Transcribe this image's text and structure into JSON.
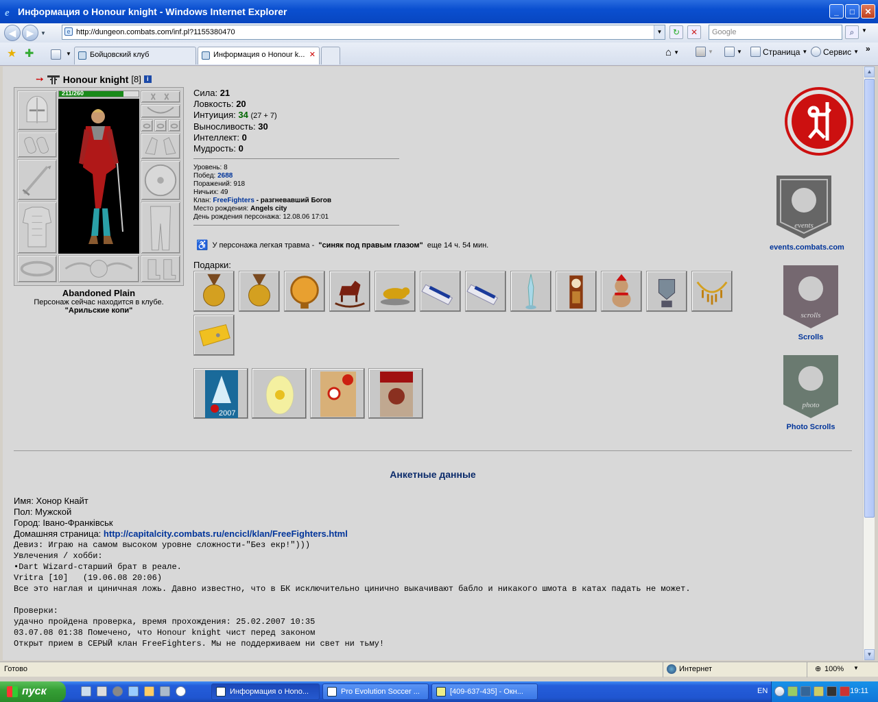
{
  "window": {
    "title": "Информация о Honour knight - Windows Internet Explorer",
    "address": "http://dungeon.combats.com/inf.pl?1155380470",
    "search_placeholder": "Google"
  },
  "tabs": [
    {
      "label": "Бойцовский клуб"
    },
    {
      "label": "Информация о Honour k..."
    }
  ],
  "toolbar": {
    "page": "Страница",
    "tools": "Сервис"
  },
  "character": {
    "name": "Honour knight",
    "level": "[8]",
    "hp": "211/260",
    "hp_fraction": 0.81,
    "location": "Abandoned Plain",
    "status_line": "Персонаж сейчас находится в клубе.",
    "place": "\"Арильские копи\""
  },
  "stats": {
    "strength_label": "Сила:",
    "strength": "21",
    "agility_label": "Ловкость:",
    "agility": "20",
    "intuition_label": "Интуиция:",
    "intuition": "34",
    "intuition_extra": "(27 + 7)",
    "endurance_label": "Выносливость:",
    "endurance": "30",
    "intellect_label": "Интеллект:",
    "intellect": "0",
    "wisdom_label": "Мудрость:",
    "wisdom": "0"
  },
  "record": {
    "level_label": "Уровень:",
    "level": "8",
    "wins_label": "Побед:",
    "wins": "2688",
    "losses_label": "Поражений:",
    "losses": "918",
    "draws_label": "Ничьих:",
    "draws": "49",
    "clan_label": "Клан:",
    "clan": "FreeFighters",
    "clan_title": "- разгневавший Богов",
    "birthplace_label": "Место рождения:",
    "birthplace": "Angels city",
    "birthday_label": "День рождения персонажа:",
    "birthday": "12.08.06 17:01"
  },
  "injury": {
    "prefix": "У персонажа легкая травма -",
    "name": "\"синяк под правым глазом\"",
    "suffix": "еще 14 ч. 54 мин."
  },
  "gifts_label": "Подарки:",
  "banners": {
    "events": "events.combats.com",
    "events_word": "events",
    "scrolls": "Scrolls",
    "scrolls_word": "scrolls",
    "photo": "Photo Scrolls",
    "photo_word": "photo",
    "year": "2007"
  },
  "profile": {
    "heading": "Анкетные данные",
    "name_line": "Имя: Хонор Кнайт",
    "sex_line": "Пол: Мужской",
    "city_line": "Город: Івано-Франківськ",
    "homepage_label": "Домашняя страница:",
    "homepage": "http://capitalcity.combats.ru/encicl/klan/FreeFighters.html",
    "motto_line": "Девиз: Играю на самом высоком уровне сложности-\"Без екр!\")))",
    "hobbies_label": "Увлечения / хобби:",
    "hobby1": "•Dart Wizard-старший брат в реале.",
    "hobby2": "Vritra [10]   (19.06.08 20:06)",
    "hobby3": "Все это наглая и циничная ложь. Давно известно, что в БК исключительно цинично выкачивают бабло и никакого шмота в катах падать не может.",
    "checks_label": "Проверки:",
    "check1": "удачно пройдена проверка, время прохождения: 25.02.2007 10:35",
    "check2": "03.07.08 01:38 Помечено, что Honour knight чист перед законом",
    "check3": "Открыт прием в СЕРЫЙ клан FreeFighters. Мы не поддерживаем ни свет ни тьму!"
  },
  "status": {
    "left": "Готово",
    "zone": "Интернет",
    "zoom": "100%"
  },
  "taskbar": {
    "start": "пуск",
    "items": [
      "Информация о Hono...",
      "Pro Evolution Soccer ...",
      "[409-637-435] - Окн..."
    ],
    "lang": "EN",
    "clock": "19:11"
  }
}
